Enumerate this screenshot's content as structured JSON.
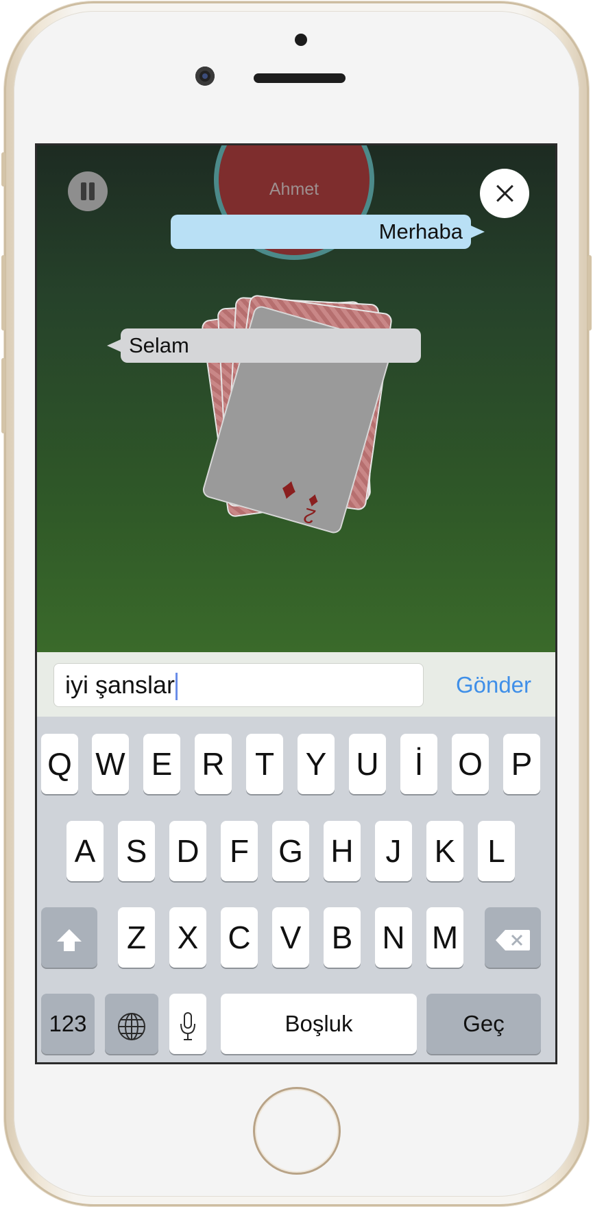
{
  "game": {
    "player_name": "Ahmet",
    "bubble_right": "Merhaba",
    "bubble_left": "Selam"
  },
  "chat": {
    "input_value": "iyi şanslar",
    "send_label": "Gönder"
  },
  "keyboard": {
    "row1": [
      "Q",
      "W",
      "E",
      "R",
      "T",
      "Y",
      "U",
      "İ",
      "O",
      "P"
    ],
    "row2": [
      "A",
      "S",
      "D",
      "F",
      "G",
      "H",
      "J",
      "K",
      "L"
    ],
    "row3": [
      "Z",
      "X",
      "C",
      "V",
      "B",
      "N",
      "M"
    ],
    "numbers_label": "123",
    "space_label": "Boşluk",
    "return_label": "Geç"
  },
  "colors": {
    "table_felt": "#2f5828",
    "send_accent": "#3f8fe8",
    "bubble_blue": "#b9e0f5"
  }
}
